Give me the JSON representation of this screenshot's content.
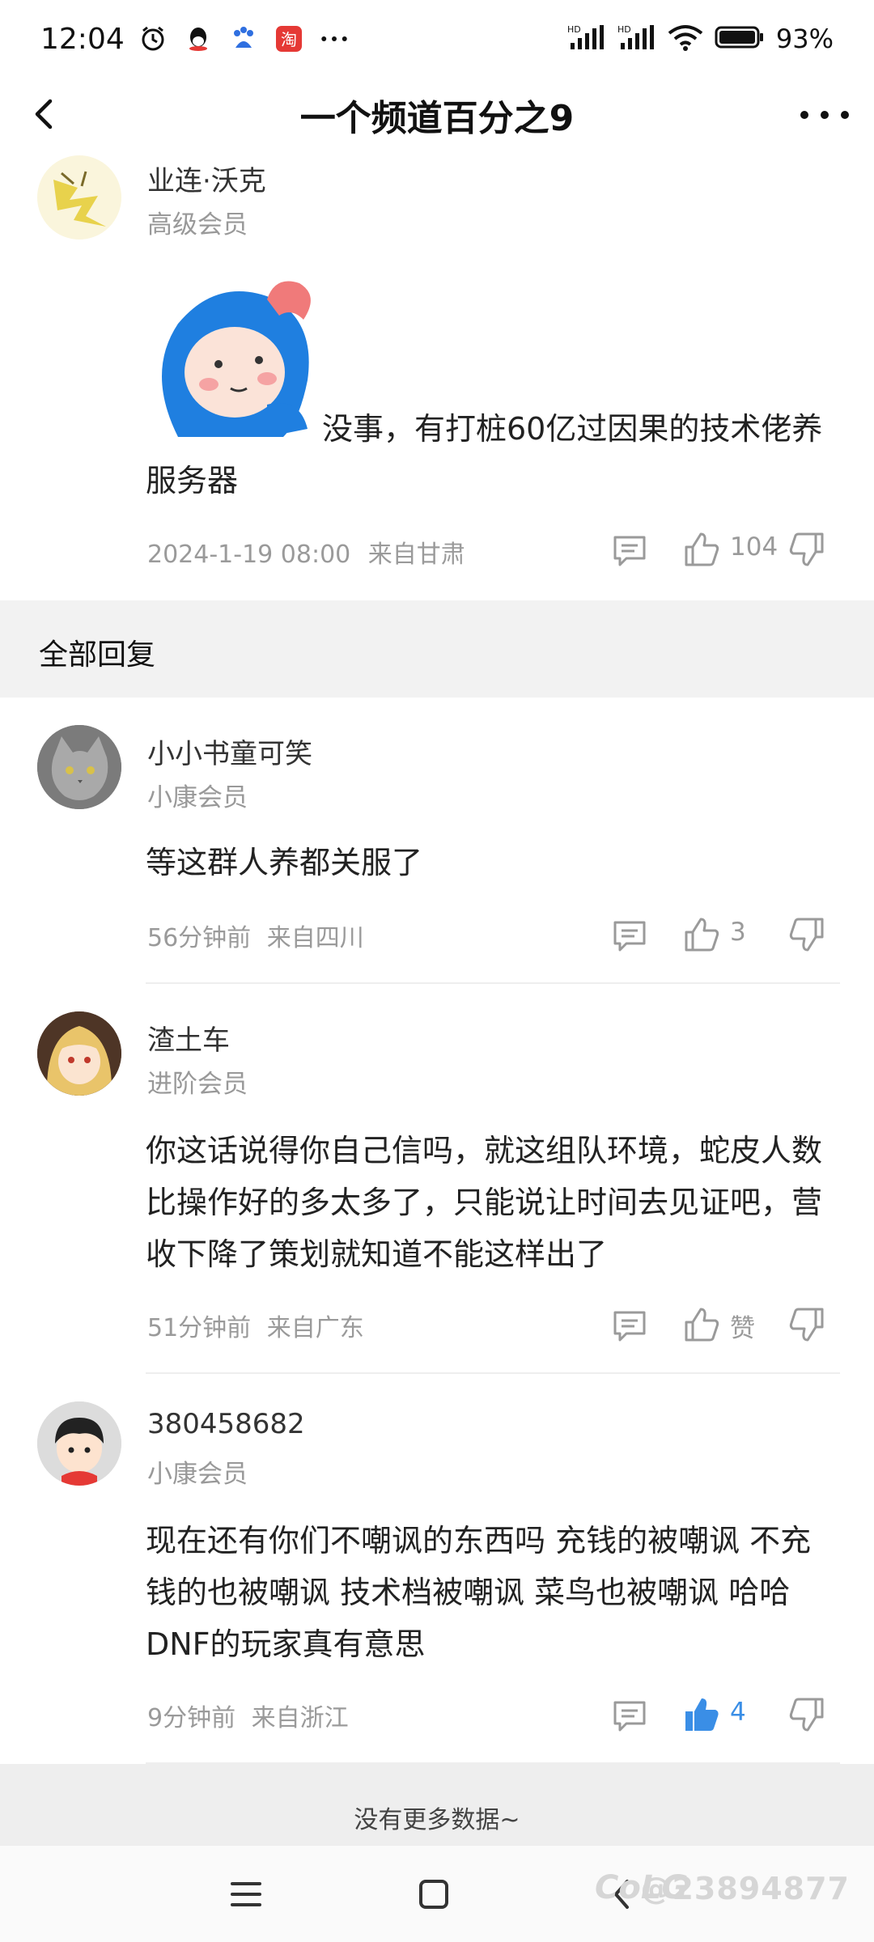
{
  "status_bar": {
    "time": "12:04",
    "battery": "93%",
    "icons_left": [
      "alarm-icon",
      "qq-icon",
      "baidu-icon",
      "taobao-icon",
      "more-dots-icon"
    ],
    "icons_right": [
      "hd-signal-1-icon",
      "hd-signal-2-icon",
      "wifi-icon",
      "battery-icon"
    ]
  },
  "header": {
    "title": "一个频道百分之9"
  },
  "main_post": {
    "author": "业连·沃克",
    "level": "高级会员",
    "text": "没事，有打桩60亿过因果的技术佬养服务器",
    "time": "2024-1-19 08:00",
    "location": "来自甘肃",
    "likes": "104"
  },
  "section": {
    "title": "全部回复"
  },
  "replies": [
    {
      "author": "小小书童可笑",
      "level": "小康会员",
      "text": "等这群人养都关服了",
      "time": "56分钟前",
      "location": "来自四川",
      "likes": "3",
      "liked": false
    },
    {
      "author": "渣土车",
      "level": "进阶会员",
      "text": "你这话说得你自己信吗，就这组队环境，蛇皮人数比操作好的多太多了，只能说让时间去见证吧，营收下降了策划就知道不能这样出了",
      "time": "51分钟前",
      "location": "来自广东",
      "likes": "赞",
      "liked": false
    },
    {
      "author": "380458682",
      "level": "小康会员",
      "text": "现在还有你们不嘲讽的东西吗 充钱的被嘲讽 不充钱的也被嘲讽 技术档被嘲讽 菜鸟也被嘲讽 哈哈DNF的玩家真有意思",
      "time": "9分钟前",
      "location": "来自浙江",
      "likes": "4",
      "liked": true
    }
  ],
  "footer": {
    "no_more": "没有更多数据~"
  },
  "watermark": {
    "logo": "CoLG",
    "user": "@23894877"
  },
  "colors": {
    "accent_blue": "#3a8ee6",
    "meta_gray": "#9a9a9a",
    "band_gray": "#f2f2f2"
  }
}
